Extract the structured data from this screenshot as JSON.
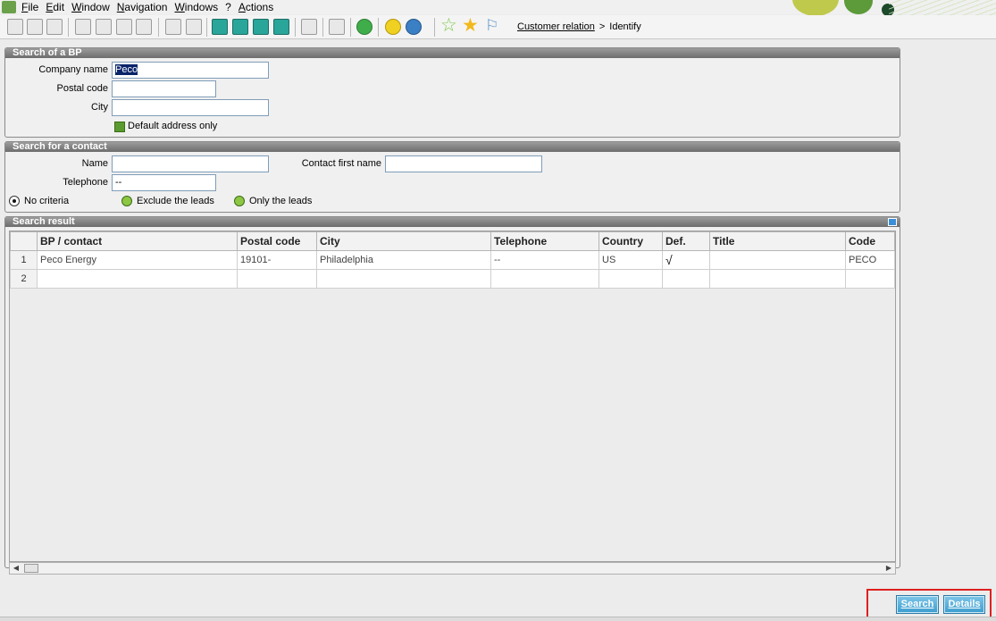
{
  "menu": [
    "File",
    "Edit",
    "Window",
    "Navigation",
    "Windows",
    "?",
    "Actions"
  ],
  "breadcrumb": {
    "link": "Customer relation",
    "separator": ">",
    "current": "Identify"
  },
  "search_bp": {
    "title": "Search of a BP",
    "company_label": "Company name",
    "company_value": "Peco",
    "postal_label": "Postal code",
    "postal_value": "",
    "city_label": "City",
    "city_value": "",
    "default_address_label": "Default address only"
  },
  "search_contact": {
    "title": "Search for a contact",
    "name_label": "Name",
    "name_value": "",
    "first_name_label": "Contact first name",
    "first_name_value": "",
    "telephone_label": "Telephone",
    "telephone_value": "--",
    "radios": [
      "No criteria",
      "Exclude the leads",
      "Only the leads"
    ],
    "selected_radio": "No criteria"
  },
  "results": {
    "title": "Search result",
    "columns": [
      "BP / contact",
      "Postal code",
      "City",
      "Telephone",
      "Country",
      "Def.",
      "Title",
      "Code"
    ],
    "rows": [
      {
        "num": "1",
        "bp": "Peco Energy",
        "postal": "19101-",
        "city": "Philadelphia",
        "telephone": "--",
        "country": "US",
        "def": "√",
        "title": "",
        "code": "PECO"
      },
      {
        "num": "2",
        "bp": "",
        "postal": "",
        "city": "",
        "telephone": "",
        "country": "",
        "def": "",
        "title": "",
        "code": ""
      }
    ]
  },
  "buttons": {
    "search": "Search",
    "details": "Details"
  }
}
